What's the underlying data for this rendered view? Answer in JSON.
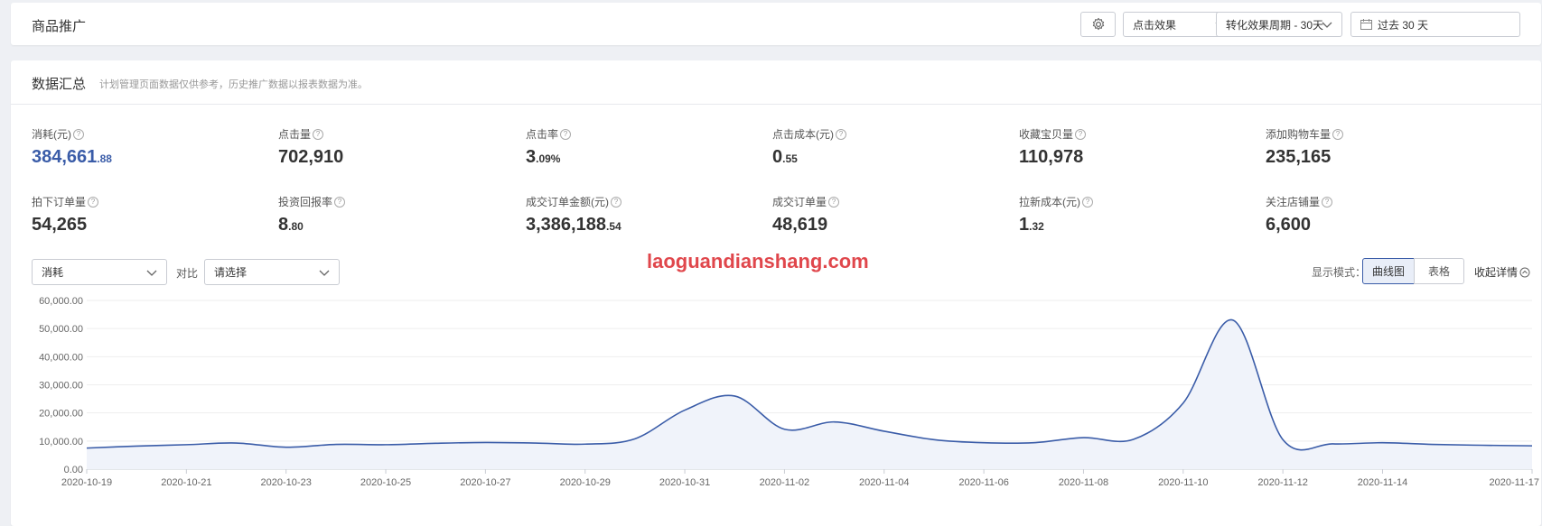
{
  "header": {
    "title": "商品推广",
    "click_effect_label": "点击效果",
    "cycle_label": "转化效果周期 - 30天",
    "date_range_label": "过去 30 天"
  },
  "summary": {
    "title": "数据汇总",
    "note": "计划管理页面数据仅供参考，历史推广数据以报表数据为准。",
    "metrics": [
      {
        "label": "消耗(元)",
        "int": "384,661",
        "dec": ".88"
      },
      {
        "label": "点击量",
        "int": "702,910",
        "dec": ""
      },
      {
        "label": "点击率",
        "int": "3",
        "dec": ".09%"
      },
      {
        "label": "点击成本(元)",
        "int": "0",
        "dec": ".55"
      },
      {
        "label": "收藏宝贝量",
        "int": "110,978",
        "dec": ""
      },
      {
        "label": "添加购物车量",
        "int": "235,165",
        "dec": ""
      },
      {
        "label": "拍下订单量",
        "int": "54,265",
        "dec": ""
      },
      {
        "label": "投资回报率",
        "int": "8",
        "dec": ".80"
      },
      {
        "label": "成交订单金额(元)",
        "int": "3,386,188",
        "dec": ".54"
      },
      {
        "label": "成交订单量",
        "int": "48,619",
        "dec": ""
      },
      {
        "label": "拉新成本(元)",
        "int": "1",
        "dec": ".32"
      },
      {
        "label": "关注店铺量",
        "int": "6,600",
        "dec": ""
      }
    ]
  },
  "controls": {
    "metric_select": "消耗",
    "compare_label": "对比",
    "compare_select": "请选择",
    "display_mode_label": "显示模式：",
    "curve_label": "曲线图",
    "table_label": "表格",
    "collapse_label": "收起详情"
  },
  "watermark": "laoguandianshang.com",
  "colors": {
    "accent": "#3a5ca8",
    "line": "#3a5ca8",
    "area": "#f0f3fa",
    "watermark": "#e0474c"
  },
  "icons": {
    "settings": "gear-icon",
    "calendar": "calendar-icon",
    "dropdown": "chevron-down-icon",
    "help": "question-circle-icon",
    "collapse": "chevron-up-circle-icon"
  },
  "chart_data": {
    "type": "area",
    "ylim": [
      0,
      60000
    ],
    "yticks": [
      "60,000.00",
      "50,000.00",
      "40,000.00",
      "30,000.00",
      "20,000.00",
      "10,000.00",
      "0.00"
    ],
    "ytick_values": [
      60000,
      50000,
      40000,
      30000,
      20000,
      10000,
      0
    ],
    "x_labels": [
      "2020-10-19",
      "2020-10-21",
      "2020-10-23",
      "2020-10-25",
      "2020-10-27",
      "2020-10-29",
      "2020-10-31",
      "2020-11-02",
      "2020-11-04",
      "2020-11-06",
      "2020-11-08",
      "2020-11-10",
      "2020-11-12",
      "2020-11-14",
      "2020-11-17"
    ],
    "x": [
      "2020-10-19",
      "2020-10-20",
      "2020-10-21",
      "2020-10-22",
      "2020-10-23",
      "2020-10-24",
      "2020-10-25",
      "2020-10-26",
      "2020-10-27",
      "2020-10-28",
      "2020-10-29",
      "2020-10-30",
      "2020-10-31",
      "2020-11-01",
      "2020-11-02",
      "2020-11-03",
      "2020-11-04",
      "2020-11-05",
      "2020-11-06",
      "2020-11-07",
      "2020-11-08",
      "2020-11-09",
      "2020-11-10",
      "2020-11-11",
      "2020-11-12",
      "2020-11-13",
      "2020-11-14",
      "2020-11-15",
      "2020-11-16",
      "2020-11-17"
    ],
    "values": [
      7500,
      8200,
      8700,
      9300,
      7800,
      8800,
      8700,
      9200,
      9500,
      9300,
      8900,
      10800,
      21000,
      26000,
      14200,
      16800,
      13500,
      10500,
      9400,
      9400,
      11200,
      10600,
      23500,
      53000,
      10500,
      9000,
      9400,
      8800,
      8500,
      8300
    ],
    "grid": true,
    "legend": "none"
  }
}
